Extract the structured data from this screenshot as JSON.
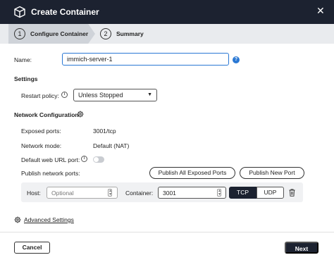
{
  "dialog": {
    "title": "Create Container",
    "close_glyph": "✕"
  },
  "steps": [
    {
      "number": "1",
      "label": "Configure Container",
      "active": true
    },
    {
      "number": "2",
      "label": "Summary",
      "active": false
    }
  ],
  "name": {
    "label": "Name:",
    "value": "immich-server-1"
  },
  "settings": {
    "heading": "Settings",
    "restart_policy_label": "Restart policy:",
    "restart_policy_value": "Unless Stopped"
  },
  "network": {
    "heading": "Network Configuration",
    "exposed_ports_label": "Exposed ports:",
    "exposed_ports_value": "3001/tcp",
    "network_mode_label": "Network mode:",
    "network_mode_value": "Default (NAT)",
    "default_web_url_label": "Default web URL port:",
    "default_web_url_enabled": false,
    "publish_label": "Publish network ports:",
    "publish_all_button": "Publish All Exposed Ports",
    "publish_new_button": "Publish New Port",
    "port_row": {
      "host_label": "Host:",
      "host_placeholder": "Optional",
      "container_label": "Container:",
      "container_value": "3001",
      "protocols": [
        "TCP",
        "UDP"
      ],
      "selected_protocol": "TCP"
    }
  },
  "advanced_settings_link": "Advanced Settings",
  "footer": {
    "cancel": "Cancel",
    "next": "Next"
  },
  "colors": {
    "titlebar": "#1c2230",
    "accent": "#2a78d4",
    "step_active_bg": "#cfd3d9",
    "step_bar_bg": "#e9ebee"
  },
  "icons": [
    "cube-icon",
    "close-icon",
    "help-icon",
    "info-icon",
    "gear-icon",
    "chevron-down-icon",
    "trash-icon"
  ]
}
